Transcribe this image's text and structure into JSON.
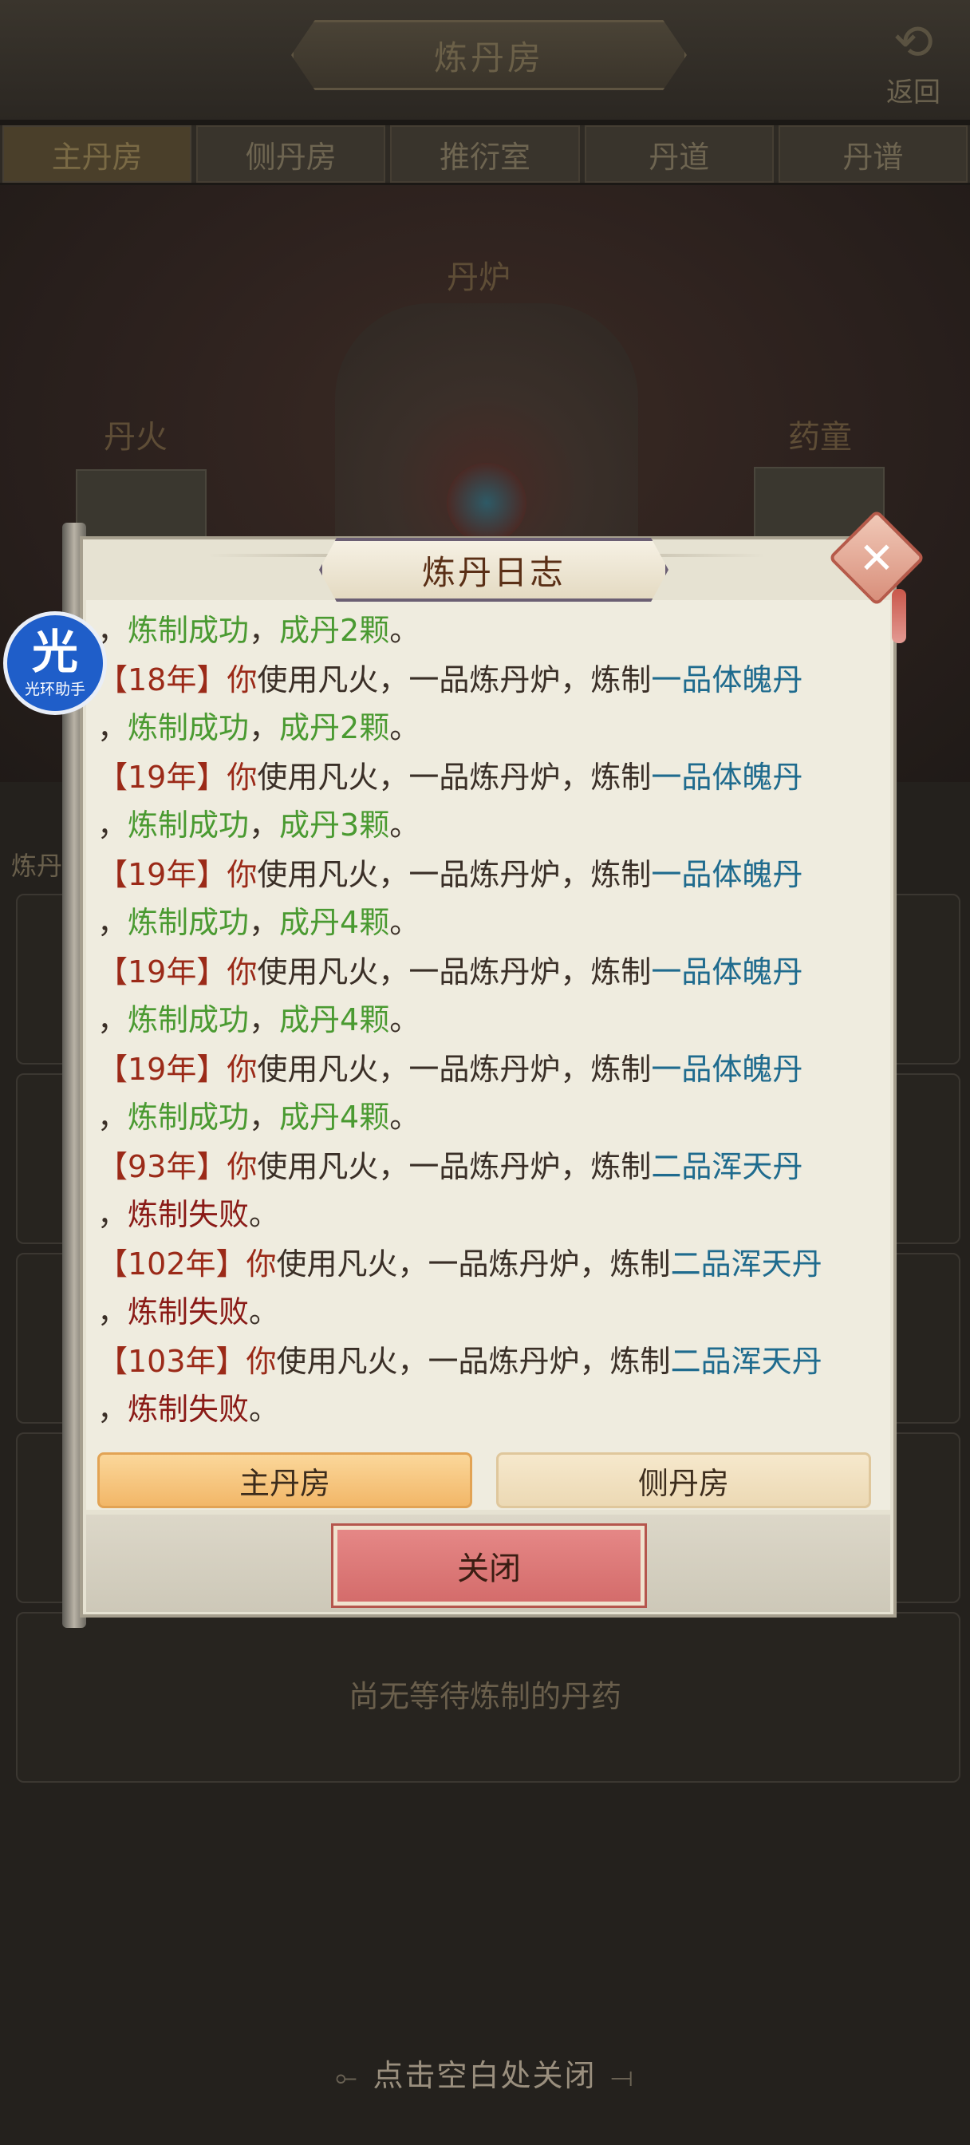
{
  "header": {
    "title": "炼丹房",
    "back_label": "返回"
  },
  "tabs": [
    {
      "label": "主丹房",
      "active": true
    },
    {
      "label": "侧丹房",
      "active": false
    },
    {
      "label": "推衍室",
      "active": false
    },
    {
      "label": "丹道",
      "active": false
    },
    {
      "label": "丹谱",
      "active": false
    }
  ],
  "scene": {
    "furnace_label": "丹炉",
    "fire_label": "丹火",
    "servant_label": "药童"
  },
  "background": {
    "side_text": "炼丹",
    "empty_note": "尚无等待炼制的丹药"
  },
  "helper": {
    "glyph": "光",
    "name": "光环助手"
  },
  "dialog": {
    "title": "炼丹日志",
    "close_button": "关闭",
    "tabs": {
      "main": "主丹房",
      "side": "侧丹房"
    }
  },
  "log_entries": [
    {
      "line1": [],
      "line2": [
        [
          "，",
          "dark"
        ],
        [
          "炼制成功",
          "green"
        ],
        [
          "，",
          "dark"
        ],
        [
          "成丹2颗",
          "green"
        ],
        [
          "。",
          "dark"
        ]
      ]
    },
    {
      "line1": [
        [
          "【18年】",
          "red"
        ],
        [
          "你",
          "red"
        ],
        [
          "使用凡火，一品炼丹炉，炼制",
          "dark"
        ],
        [
          "一品体魄丹",
          "blue"
        ]
      ],
      "line2": [
        [
          "，",
          "dark"
        ],
        [
          "炼制成功",
          "green"
        ],
        [
          "，",
          "dark"
        ],
        [
          "成丹2颗",
          "green"
        ],
        [
          "。",
          "dark"
        ]
      ]
    },
    {
      "line1": [
        [
          "【19年】",
          "red"
        ],
        [
          "你",
          "red"
        ],
        [
          "使用凡火，一品炼丹炉，炼制",
          "dark"
        ],
        [
          "一品体魄丹",
          "blue"
        ]
      ],
      "line2": [
        [
          "，",
          "dark"
        ],
        [
          "炼制成功",
          "green"
        ],
        [
          "，",
          "dark"
        ],
        [
          "成丹3颗",
          "green"
        ],
        [
          "。",
          "dark"
        ]
      ]
    },
    {
      "line1": [
        [
          "【19年】",
          "red"
        ],
        [
          "你",
          "red"
        ],
        [
          "使用凡火，一品炼丹炉，炼制",
          "dark"
        ],
        [
          "一品体魄丹",
          "blue"
        ]
      ],
      "line2": [
        [
          "，",
          "dark"
        ],
        [
          "炼制成功",
          "green"
        ],
        [
          "，",
          "dark"
        ],
        [
          "成丹4颗",
          "green"
        ],
        [
          "。",
          "dark"
        ]
      ]
    },
    {
      "line1": [
        [
          "【19年】",
          "red"
        ],
        [
          "你",
          "red"
        ],
        [
          "使用凡火，一品炼丹炉，炼制",
          "dark"
        ],
        [
          "一品体魄丹",
          "blue"
        ]
      ],
      "line2": [
        [
          "，",
          "dark"
        ],
        [
          "炼制成功",
          "green"
        ],
        [
          "，",
          "dark"
        ],
        [
          "成丹4颗",
          "green"
        ],
        [
          "。",
          "dark"
        ]
      ]
    },
    {
      "line1": [
        [
          "【19年】",
          "red"
        ],
        [
          "你",
          "red"
        ],
        [
          "使用凡火，一品炼丹炉，炼制",
          "dark"
        ],
        [
          "一品体魄丹",
          "blue"
        ]
      ],
      "line2": [
        [
          "，",
          "dark"
        ],
        [
          "炼制成功",
          "green"
        ],
        [
          "，",
          "dark"
        ],
        [
          "成丹4颗",
          "green"
        ],
        [
          "。",
          "dark"
        ]
      ]
    },
    {
      "line1": [
        [
          "【93年】",
          "red"
        ],
        [
          "你",
          "red"
        ],
        [
          "使用凡火，一品炼丹炉，炼制",
          "dark"
        ],
        [
          "二品浑天丹",
          "blue"
        ]
      ],
      "line2": [
        [
          "，",
          "dark"
        ],
        [
          "炼制失败",
          "maroon"
        ],
        [
          "。",
          "dark"
        ]
      ]
    },
    {
      "line1": [
        [
          "【102年】",
          "red"
        ],
        [
          "你",
          "red"
        ],
        [
          "使用凡火，一品炼丹炉，炼制",
          "dark"
        ],
        [
          "二品浑天丹",
          "blue"
        ]
      ],
      "line2": [
        [
          "，",
          "dark"
        ],
        [
          "炼制失败",
          "maroon"
        ],
        [
          "。",
          "dark"
        ]
      ]
    },
    {
      "line1": [
        [
          "【103年】",
          "red"
        ],
        [
          "你",
          "red"
        ],
        [
          "使用凡火，一品炼丹炉，炼制",
          "dark"
        ],
        [
          "二品浑天丹",
          "blue"
        ]
      ],
      "line2": [
        [
          "，",
          "dark"
        ],
        [
          "炼制失败",
          "maroon"
        ],
        [
          "。",
          "dark"
        ]
      ]
    }
  ],
  "footer_hint": "点击空白处关闭",
  "colors": {
    "dark": "#3a2f27",
    "red": "#9b2a18",
    "green": "#4a9a31",
    "blue": "#1f6b8e",
    "maroon": "#8a1a16"
  }
}
